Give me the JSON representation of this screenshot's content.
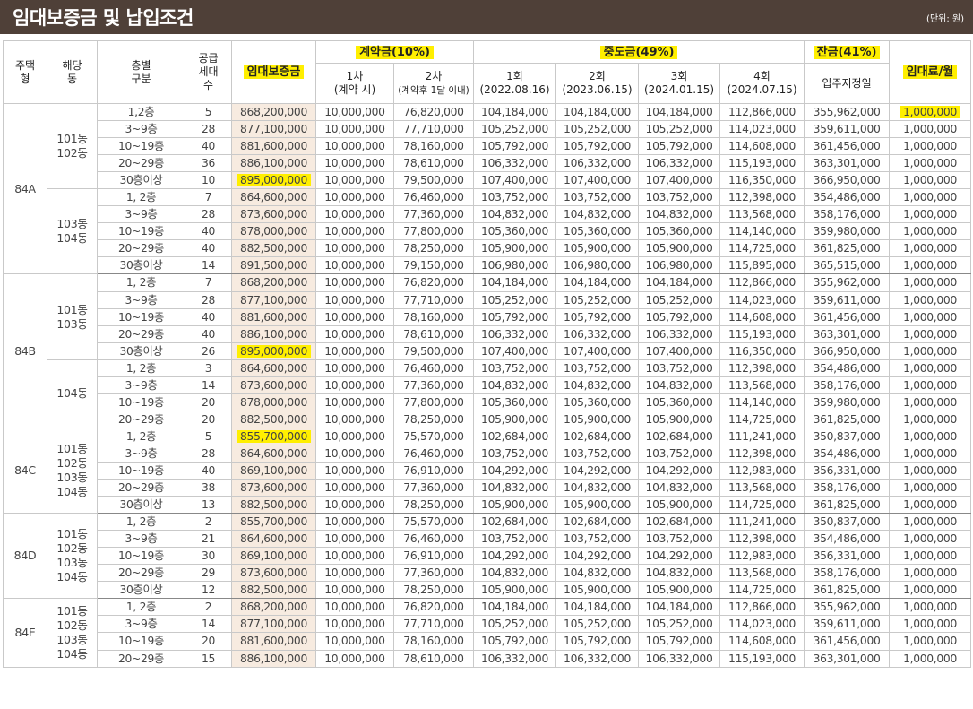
{
  "title": "임대보증금 및 납입조건",
  "unit": "(단위: 원)",
  "headers": {
    "type": "주택형",
    "dong": "해당동",
    "floor": "층별구분",
    "supply": "공급세대수",
    "deposit": "임대보증금",
    "contract_group": "계약금(10%)",
    "c1": "1차",
    "c1_sub": "(계약 시)",
    "c2": "2차",
    "c2_sub": "(계약후 1달 이내)",
    "mid_group": "중도금(49%)",
    "m1": "1회",
    "m1_date": "(2022.08.16)",
    "m2": "2회",
    "m2_date": "(2023.06.15)",
    "m3": "3회",
    "m3_date": "(2024.01.15)",
    "m4": "4회",
    "m4_date": "(2024.07.15)",
    "balance_group": "잔금(41%)",
    "balance": "입주지정일",
    "rent": "임대료/월"
  },
  "groups": [
    {
      "type": "84A",
      "dongs": [
        {
          "dong": "101동\n102동",
          "rows": [
            {
              "floor": "1,2층",
              "supply": "5",
              "deposit": "868,200,000",
              "c1": "10,000,000",
              "c2": "76,820,000",
              "m1": "104,184,000",
              "m2": "104,184,000",
              "m3": "104,184,000",
              "m4": "112,866,000",
              "bal": "355,962,000",
              "rent": "1,000,000"
            },
            {
              "floor": "3~9층",
              "supply": "28",
              "deposit": "877,100,000",
              "c1": "10,000,000",
              "c2": "77,710,000",
              "m1": "105,252,000",
              "m2": "105,252,000",
              "m3": "105,252,000",
              "m4": "114,023,000",
              "bal": "359,611,000",
              "rent": "1,000,000"
            },
            {
              "floor": "10~19층",
              "supply": "40",
              "deposit": "881,600,000",
              "c1": "10,000,000",
              "c2": "78,160,000",
              "m1": "105,792,000",
              "m2": "105,792,000",
              "m3": "105,792,000",
              "m4": "114,608,000",
              "bal": "361,456,000",
              "rent": "1,000,000"
            },
            {
              "floor": "20~29층",
              "supply": "36",
              "deposit": "886,100,000",
              "c1": "10,000,000",
              "c2": "78,610,000",
              "m1": "106,332,000",
              "m2": "106,332,000",
              "m3": "106,332,000",
              "m4": "115,193,000",
              "bal": "363,301,000",
              "rent": "1,000,000"
            },
            {
              "floor": "30층이상",
              "supply": "10",
              "deposit": "895,000,000",
              "c1": "10,000,000",
              "c2": "79,500,000",
              "m1": "107,400,000",
              "m2": "107,400,000",
              "m3": "107,400,000",
              "m4": "116,350,000",
              "bal": "366,950,000",
              "rent": "1,000,000"
            }
          ]
        },
        {
          "dong": "103동\n104동",
          "rows": [
            {
              "floor": "1, 2층",
              "supply": "7",
              "deposit": "864,600,000",
              "c1": "10,000,000",
              "c2": "76,460,000",
              "m1": "103,752,000",
              "m2": "103,752,000",
              "m3": "103,752,000",
              "m4": "112,398,000",
              "bal": "354,486,000",
              "rent": "1,000,000"
            },
            {
              "floor": "3~9층",
              "supply": "28",
              "deposit": "873,600,000",
              "c1": "10,000,000",
              "c2": "77,360,000",
              "m1": "104,832,000",
              "m2": "104,832,000",
              "m3": "104,832,000",
              "m4": "113,568,000",
              "bal": "358,176,000",
              "rent": "1,000,000"
            },
            {
              "floor": "10~19층",
              "supply": "40",
              "deposit": "878,000,000",
              "c1": "10,000,000",
              "c2": "77,800,000",
              "m1": "105,360,000",
              "m2": "105,360,000",
              "m3": "105,360,000",
              "m4": "114,140,000",
              "bal": "359,980,000",
              "rent": "1,000,000"
            },
            {
              "floor": "20~29층",
              "supply": "40",
              "deposit": "882,500,000",
              "c1": "10,000,000",
              "c2": "78,250,000",
              "m1": "105,900,000",
              "m2": "105,900,000",
              "m3": "105,900,000",
              "m4": "114,725,000",
              "bal": "361,825,000",
              "rent": "1,000,000"
            },
            {
              "floor": "30층이상",
              "supply": "14",
              "deposit": "891,500,000",
              "c1": "10,000,000",
              "c2": "79,150,000",
              "m1": "106,980,000",
              "m2": "106,980,000",
              "m3": "106,980,000",
              "m4": "115,895,000",
              "bal": "365,515,000",
              "rent": "1,000,000"
            }
          ]
        }
      ]
    },
    {
      "type": "84B",
      "dongs": [
        {
          "dong": "101동\n103동",
          "rows": [
            {
              "floor": "1, 2층",
              "supply": "7",
              "deposit": "868,200,000",
              "c1": "10,000,000",
              "c2": "76,820,000",
              "m1": "104,184,000",
              "m2": "104,184,000",
              "m3": "104,184,000",
              "m4": "112,866,000",
              "bal": "355,962,000",
              "rent": "1,000,000"
            },
            {
              "floor": "3~9층",
              "supply": "28",
              "deposit": "877,100,000",
              "c1": "10,000,000",
              "c2": "77,710,000",
              "m1": "105,252,000",
              "m2": "105,252,000",
              "m3": "105,252,000",
              "m4": "114,023,000",
              "bal": "359,611,000",
              "rent": "1,000,000"
            },
            {
              "floor": "10~19층",
              "supply": "40",
              "deposit": "881,600,000",
              "c1": "10,000,000",
              "c2": "78,160,000",
              "m1": "105,792,000",
              "m2": "105,792,000",
              "m3": "105,792,000",
              "m4": "114,608,000",
              "bal": "361,456,000",
              "rent": "1,000,000"
            },
            {
              "floor": "20~29층",
              "supply": "40",
              "deposit": "886,100,000",
              "c1": "10,000,000",
              "c2": "78,610,000",
              "m1": "106,332,000",
              "m2": "106,332,000",
              "m3": "106,332,000",
              "m4": "115,193,000",
              "bal": "363,301,000",
              "rent": "1,000,000"
            },
            {
              "floor": "30층이상",
              "supply": "26",
              "deposit": "895,000,000",
              "c1": "10,000,000",
              "c2": "79,500,000",
              "m1": "107,400,000",
              "m2": "107,400,000",
              "m3": "107,400,000",
              "m4": "116,350,000",
              "bal": "366,950,000",
              "rent": "1,000,000"
            }
          ]
        },
        {
          "dong": "104동",
          "rows": [
            {
              "floor": "1, 2층",
              "supply": "3",
              "deposit": "864,600,000",
              "c1": "10,000,000",
              "c2": "76,460,000",
              "m1": "103,752,000",
              "m2": "103,752,000",
              "m3": "103,752,000",
              "m4": "112,398,000",
              "bal": "354,486,000",
              "rent": "1,000,000"
            },
            {
              "floor": "3~9층",
              "supply": "14",
              "deposit": "873,600,000",
              "c1": "10,000,000",
              "c2": "77,360,000",
              "m1": "104,832,000",
              "m2": "104,832,000",
              "m3": "104,832,000",
              "m4": "113,568,000",
              "bal": "358,176,000",
              "rent": "1,000,000"
            },
            {
              "floor": "10~19층",
              "supply": "20",
              "deposit": "878,000,000",
              "c1": "10,000,000",
              "c2": "77,800,000",
              "m1": "105,360,000",
              "m2": "105,360,000",
              "m3": "105,360,000",
              "m4": "114,140,000",
              "bal": "359,980,000",
              "rent": "1,000,000"
            },
            {
              "floor": "20~29층",
              "supply": "20",
              "deposit": "882,500,000",
              "c1": "10,000,000",
              "c2": "78,250,000",
              "m1": "105,900,000",
              "m2": "105,900,000",
              "m3": "105,900,000",
              "m4": "114,725,000",
              "bal": "361,825,000",
              "rent": "1,000,000"
            }
          ]
        }
      ]
    },
    {
      "type": "84C",
      "dongs": [
        {
          "dong": "101동\n102동\n103동\n104동",
          "rows": [
            {
              "floor": "1, 2층",
              "supply": "5",
              "deposit": "855,700,000",
              "c1": "10,000,000",
              "c2": "75,570,000",
              "m1": "102,684,000",
              "m2": "102,684,000",
              "m3": "102,684,000",
              "m4": "111,241,000",
              "bal": "350,837,000",
              "rent": "1,000,000"
            },
            {
              "floor": "3~9층",
              "supply": "28",
              "deposit": "864,600,000",
              "c1": "10,000,000",
              "c2": "76,460,000",
              "m1": "103,752,000",
              "m2": "103,752,000",
              "m3": "103,752,000",
              "m4": "112,398,000",
              "bal": "354,486,000",
              "rent": "1,000,000"
            },
            {
              "floor": "10~19층",
              "supply": "40",
              "deposit": "869,100,000",
              "c1": "10,000,000",
              "c2": "76,910,000",
              "m1": "104,292,000",
              "m2": "104,292,000",
              "m3": "104,292,000",
              "m4": "112,983,000",
              "bal": "356,331,000",
              "rent": "1,000,000"
            },
            {
              "floor": "20~29층",
              "supply": "38",
              "deposit": "873,600,000",
              "c1": "10,000,000",
              "c2": "77,360,000",
              "m1": "104,832,000",
              "m2": "104,832,000",
              "m3": "104,832,000",
              "m4": "113,568,000",
              "bal": "358,176,000",
              "rent": "1,000,000"
            },
            {
              "floor": "30층이상",
              "supply": "13",
              "deposit": "882,500,000",
              "c1": "10,000,000",
              "c2": "78,250,000",
              "m1": "105,900,000",
              "m2": "105,900,000",
              "m3": "105,900,000",
              "m4": "114,725,000",
              "bal": "361,825,000",
              "rent": "1,000,000"
            }
          ]
        }
      ]
    },
    {
      "type": "84D",
      "dongs": [
        {
          "dong": "101동\n102동\n103동\n104동",
          "rows": [
            {
              "floor": "1, 2층",
              "supply": "2",
              "deposit": "855,700,000",
              "c1": "10,000,000",
              "c2": "75,570,000",
              "m1": "102,684,000",
              "m2": "102,684,000",
              "m3": "102,684,000",
              "m4": "111,241,000",
              "bal": "350,837,000",
              "rent": "1,000,000"
            },
            {
              "floor": "3~9층",
              "supply": "21",
              "deposit": "864,600,000",
              "c1": "10,000,000",
              "c2": "76,460,000",
              "m1": "103,752,000",
              "m2": "103,752,000",
              "m3": "103,752,000",
              "m4": "112,398,000",
              "bal": "354,486,000",
              "rent": "1,000,000"
            },
            {
              "floor": "10~19층",
              "supply": "30",
              "deposit": "869,100,000",
              "c1": "10,000,000",
              "c2": "76,910,000",
              "m1": "104,292,000",
              "m2": "104,292,000",
              "m3": "104,292,000",
              "m4": "112,983,000",
              "bal": "356,331,000",
              "rent": "1,000,000"
            },
            {
              "floor": "20~29층",
              "supply": "29",
              "deposit": "873,600,000",
              "c1": "10,000,000",
              "c2": "77,360,000",
              "m1": "104,832,000",
              "m2": "104,832,000",
              "m3": "104,832,000",
              "m4": "113,568,000",
              "bal": "358,176,000",
              "rent": "1,000,000"
            },
            {
              "floor": "30층이상",
              "supply": "12",
              "deposit": "882,500,000",
              "c1": "10,000,000",
              "c2": "78,250,000",
              "m1": "105,900,000",
              "m2": "105,900,000",
              "m3": "105,900,000",
              "m4": "114,725,000",
              "bal": "361,825,000",
              "rent": "1,000,000"
            }
          ]
        }
      ]
    },
    {
      "type": "84E",
      "dongs": [
        {
          "dong": "101동\n102동\n103동\n104동",
          "rows": [
            {
              "floor": "1, 2층",
              "supply": "2",
              "deposit": "868,200,000",
              "c1": "10,000,000",
              "c2": "76,820,000",
              "m1": "104,184,000",
              "m2": "104,184,000",
              "m3": "104,184,000",
              "m4": "112,866,000",
              "bal": "355,962,000",
              "rent": "1,000,000"
            },
            {
              "floor": "3~9층",
              "supply": "14",
              "deposit": "877,100,000",
              "c1": "10,000,000",
              "c2": "77,710,000",
              "m1": "105,252,000",
              "m2": "105,252,000",
              "m3": "105,252,000",
              "m4": "114,023,000",
              "bal": "359,611,000",
              "rent": "1,000,000"
            },
            {
              "floor": "10~19층",
              "supply": "20",
              "deposit": "881,600,000",
              "c1": "10,000,000",
              "c2": "78,160,000",
              "m1": "105,792,000",
              "m2": "105,792,000",
              "m3": "105,792,000",
              "m4": "114,608,000",
              "bal": "361,456,000",
              "rent": "1,000,000"
            },
            {
              "floor": "20~29층",
              "supply": "15",
              "deposit": "886,100,000",
              "c1": "10,000,000",
              "c2": "78,610,000",
              "m1": "106,332,000",
              "m2": "106,332,000",
              "m3": "106,332,000",
              "m4": "115,193,000",
              "bal": "363,301,000",
              "rent": "1,000,000"
            }
          ]
        }
      ]
    }
  ],
  "highlights": [
    {
      "group": 0,
      "dong": 0,
      "row": 0,
      "field": "rent"
    },
    {
      "group": 0,
      "dong": 0,
      "row": 4,
      "field": "deposit"
    },
    {
      "group": 1,
      "dong": 0,
      "row": 4,
      "field": "deposit"
    },
    {
      "group": 2,
      "dong": 0,
      "row": 0,
      "field": "deposit"
    }
  ],
  "colors": {
    "title_bg": "#4f4038",
    "highlight": "#ffef00",
    "deposit_col": "#f7ebe0"
  }
}
